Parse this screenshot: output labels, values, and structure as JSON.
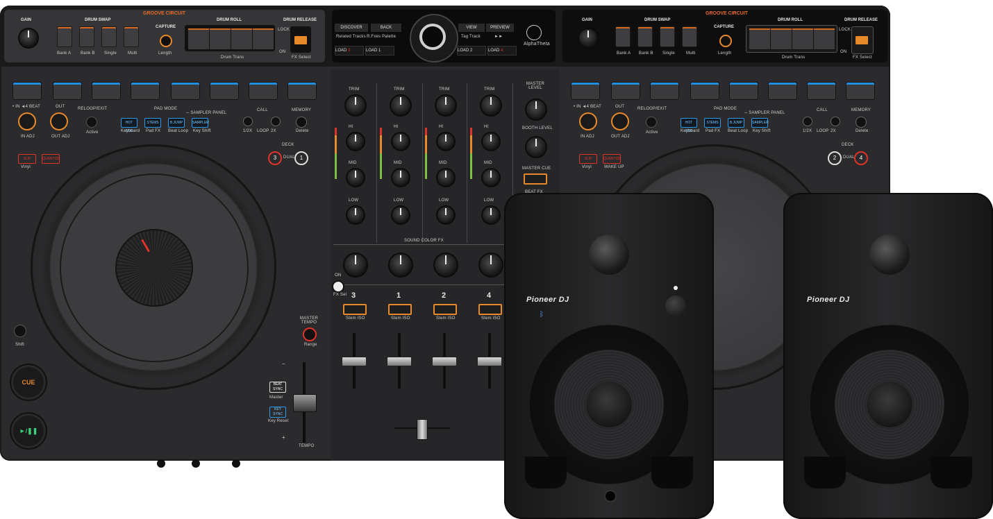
{
  "deck_left": {
    "groove_circuit": "GROOVE CIRCUIT",
    "gain": "GAIN",
    "drum_swap": "DRUM SWAP",
    "drum_swap_sub": [
      "Bank A",
      "Bank B",
      "Single",
      "Multi"
    ],
    "capture": "CAPTURE",
    "length": "Length",
    "drum_roll": "DRUM ROLL",
    "drum_roll_sub": "Drum Trans",
    "drum_release": "DRUM RELEASE",
    "lock": "LOCK",
    "on": "ON",
    "fx_select": "FX Select",
    "in_label": "• IN  ◄4 BEAT",
    "out_label": "OUT",
    "in_adj": "IN ADJ",
    "out_adj": "OUT ADJ",
    "reloop": "RELOOP/EXIT",
    "active": "Active",
    "pad_mode": "PAD MODE",
    "sampler_panel": "─ SAMPLER PANEL",
    "mode_buttons": [
      "HOT CUE",
      "STEMS",
      "B.JUMP",
      "SAMPLER"
    ],
    "mode_sub": [
      "Keyboard",
      "Pad FX",
      "Beat Loop",
      "Key Shift"
    ],
    "call": "CALL",
    "memory": "MEMORY",
    "delete": "Delete",
    "loop": "LOOP",
    "half": "1/2X",
    "double": "2X",
    "deck": "DECK",
    "dual": "DUAL",
    "deck_a": "3",
    "deck_b": "1",
    "slip": "SLIP",
    "quantize": "QUANTIZE",
    "vinyl": "Vinyl",
    "shift": "Shift",
    "cue": "CUE",
    "play": "►/❚❚",
    "master_tempo": "MASTER TEMPO",
    "range": "Range",
    "beat_sync": "BEAT SYNC",
    "master": "Master",
    "key_sync": "KEY SYNC",
    "key_reset": "Key Reset",
    "tempo": "TEMPO",
    "minus": "−",
    "plus": "+"
  },
  "center": {
    "discover": "DISCOVER",
    "back": "BACK",
    "related_tracks": "Related Tracks",
    "fx_palette": "R.Fxes Palette",
    "view": "VIEW",
    "preview": "PREVIEW",
    "tag_track": "Tag Track",
    "ff": "►►",
    "load_labels": [
      "LOAD",
      "LOAD",
      "LOAD",
      "LOAD"
    ],
    "load_numbers": [
      "3",
      "1",
      "2",
      "4"
    ],
    "logo": "AlphaTheta"
  },
  "mixer": {
    "trim": "TRIM",
    "hi": "HI",
    "mid": "MID",
    "low": "LOW",
    "master_level": "MASTER LEVEL",
    "booth_level": "BOOTH LEVEL",
    "master_cue": "MASTER CUE",
    "beat_fx": "BEAT FX",
    "sound_color_fx": "SOUND COLOR FX",
    "on": "ON",
    "fx_sel": "FX Sel",
    "channels": [
      "3",
      "1",
      "2",
      "4"
    ],
    "stem_iso": "Stem ISO"
  },
  "deck_right": {
    "groove_circuit": "GROOVE CIRCUIT",
    "gain": "GAIN",
    "drum_swap": "DRUM SWAP",
    "drum_swap_sub": [
      "Bank A",
      "Bank B",
      "Single",
      "Multi"
    ],
    "capture": "CAPTURE",
    "length": "Length",
    "drum_roll": "DRUM ROLL",
    "drum_roll_sub": "Drum Trans",
    "drum_release": "DRUM RELEASE",
    "lock": "LOCK",
    "on": "ON",
    "fx_select": "FX Select",
    "in_label": "• IN  ◄4 BEAT",
    "out_label": "OUT",
    "in_adj": "IN ADJ",
    "out_adj": "OUT ADJ",
    "reloop": "RELOOP/EXIT",
    "active": "Active",
    "pad_mode": "PAD MODE",
    "sampler_panel": "─ SAMPLER PANEL",
    "mode_buttons": [
      "HOT CUE",
      "STEMS",
      "B.JUMP",
      "SAMPLER"
    ],
    "mode_sub": [
      "Keyboard",
      "Pad FX",
      "Beat Loop",
      "Key Shift"
    ],
    "call": "CALL",
    "memory": "MEMORY",
    "delete": "Delete",
    "loop": "LOOP",
    "half": "1/2X",
    "double": "2X",
    "deck": "DECK",
    "dual": "DUAL",
    "deck_a": "2",
    "deck_b": "4",
    "slip": "SLIP",
    "quantize": "QUANTIZE",
    "vinyl": "Vinyl",
    "wake_up": "WAKE UP"
  },
  "speakers": {
    "brand": "Pioneer DJ",
    "bluetooth_icon": "bluetooth-icon"
  },
  "colors": {
    "body": "#2b2b2d",
    "accent_orange": "#e8892a",
    "accent_red": "#e0332a",
    "accent_blue": "#2a9be8"
  }
}
